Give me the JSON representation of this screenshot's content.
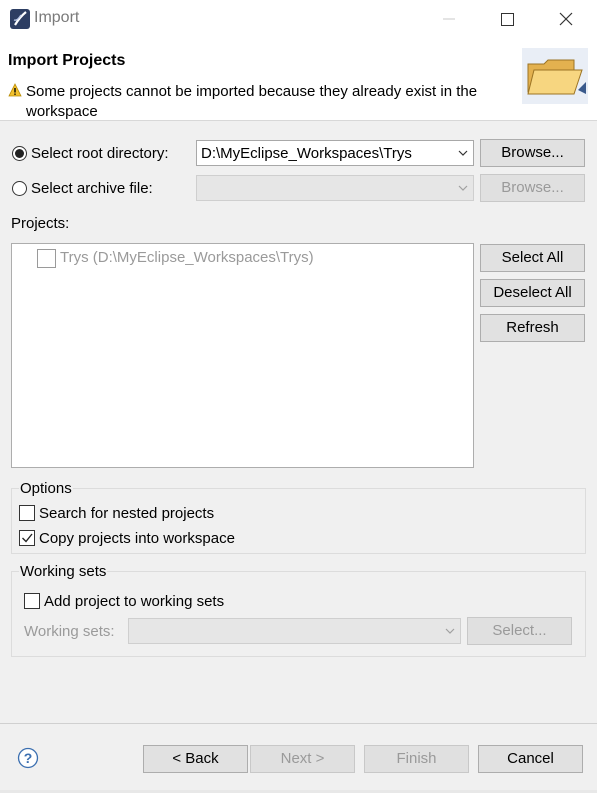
{
  "window": {
    "title": "Import",
    "icon": "eclipse-app-icon",
    "controls": [
      "minimize-icon",
      "maximize-icon",
      "close-icon"
    ]
  },
  "banner": {
    "title": "Import Projects",
    "message": "Some projects cannot be imported because they already exist in the workspace",
    "icon": "warning-icon",
    "image": "folder-icon"
  },
  "source": {
    "root_directory_label": "Select root directory:",
    "root_directory_value": "D:\\MyEclipse_Workspaces\\Trys",
    "archive_label": "Select archive file:",
    "archive_value": "",
    "browse_label": "Browse...",
    "selected": "root_directory"
  },
  "projects": {
    "label": "Projects:",
    "items": [
      {
        "label": "Trys (D:\\MyEclipse_Workspaces\\Trys)",
        "checked": false,
        "enabled": false
      }
    ],
    "select_all_label": "Select All",
    "deselect_all_label": "Deselect All",
    "refresh_label": "Refresh"
  },
  "options": {
    "legend": "Options",
    "nested_label": "Search for nested projects",
    "nested_checked": false,
    "copy_label": "Copy projects into workspace",
    "copy_checked": true
  },
  "working_sets": {
    "legend": "Working sets",
    "add_label": "Add project to working sets",
    "add_checked": false,
    "sets_label": "Working sets:",
    "sets_value": "",
    "select_label": "Select..."
  },
  "footer": {
    "help_icon": "help-icon",
    "back_label": "< Back",
    "next_label": "Next >",
    "finish_label": "Finish",
    "cancel_label": "Cancel"
  },
  "colors": {
    "background": "#f0f0f0",
    "disabled_text": "#9a9a9a",
    "help_blue": "#3b6fb0"
  }
}
